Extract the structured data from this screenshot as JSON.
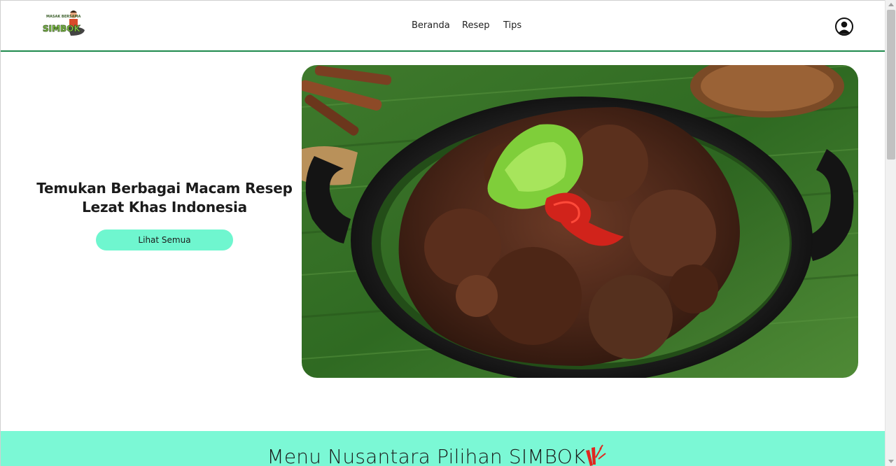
{
  "header": {
    "logo_top_text": "MASAK BERSAMA",
    "logo_main_text": "SIMBOK",
    "nav": [
      {
        "label": "Beranda"
      },
      {
        "label": "Resep"
      },
      {
        "label": "Tips"
      }
    ],
    "profile_icon": "user-circle-icon"
  },
  "hero": {
    "title_line1": "Temukan Berbagai Macam Resep",
    "title_line2": "Lezat Khas Indonesia",
    "button_label": "Lihat Semua",
    "image_icon": "rendang-dish-photo"
  },
  "section": {
    "title": "Menu Nusantara Pilihan SIMBOK",
    "decor_icon": "chili-sparkle-icon"
  },
  "colors": {
    "accent": "#6ff6cf",
    "section_bg": "#7bf8d5",
    "nav_border": "#1f8a4c",
    "text": "#1b1b1b"
  }
}
